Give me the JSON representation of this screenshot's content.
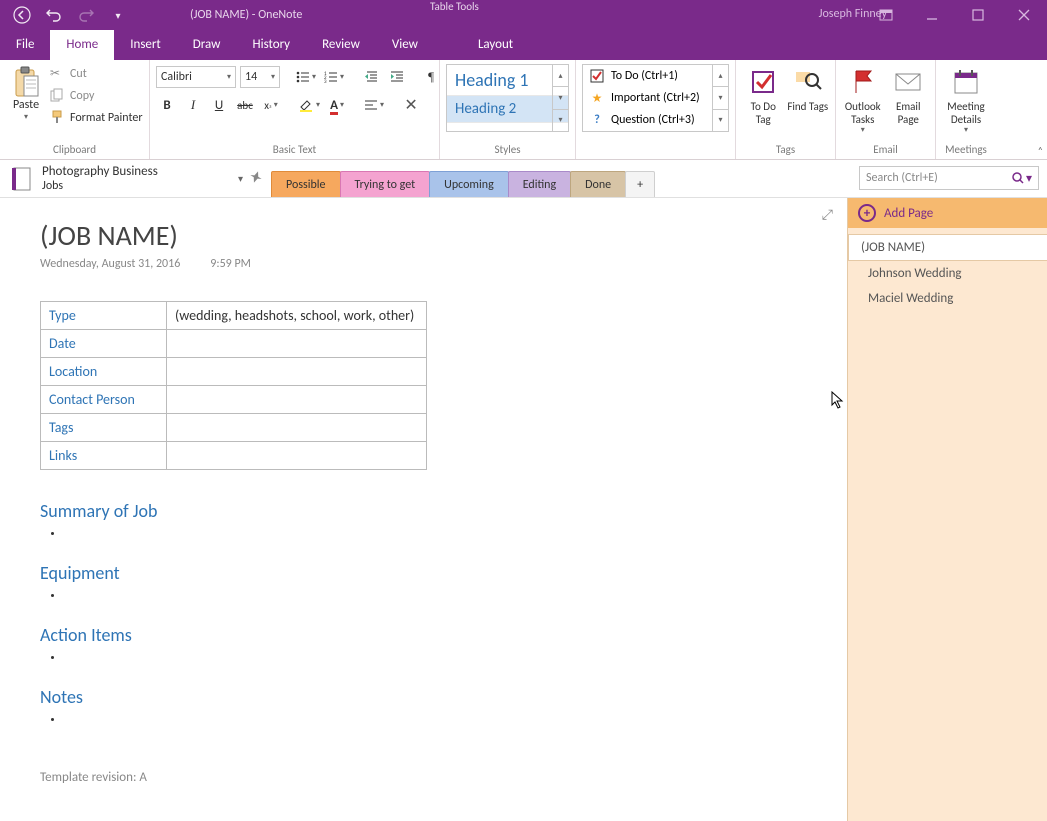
{
  "titlebar": {
    "doc_title": "(JOB NAME)  -  OneNote",
    "table_tools": "Table Tools",
    "user": "Joseph Finney"
  },
  "menu": {
    "file": "File",
    "home": "Home",
    "insert": "Insert",
    "draw": "Draw",
    "history": "History",
    "review": "Review",
    "view": "View",
    "layout": "Layout"
  },
  "ribbon": {
    "clipboard": {
      "paste": "Paste",
      "cut": "Cut",
      "copy": "Copy",
      "format_painter": "Format Painter",
      "label": "Clipboard"
    },
    "basic_text": {
      "font": "Calibri",
      "size": "14",
      "label": "Basic Text"
    },
    "styles": {
      "heading1": "Heading 1",
      "heading2": "Heading 2",
      "label": "Styles"
    },
    "tags": {
      "todo": "To Do (Ctrl+1)",
      "important": "Important (Ctrl+2)",
      "question": "Question (Ctrl+3)",
      "label": "Tags",
      "todo_tag": "To Do Tag",
      "find_tags": "Find Tags"
    },
    "email": {
      "outlook": "Outlook Tasks",
      "email_page": "Email Page",
      "label": "Email"
    },
    "meetings": {
      "details": "Meeting Details",
      "label": "Meetings"
    }
  },
  "notebook": {
    "name": "Photography Business",
    "section": "Jobs"
  },
  "tabs": {
    "possible": "Possible",
    "trying": "Trying to get",
    "upcoming": "Upcoming",
    "editing": "Editing",
    "done": "Done",
    "add": "+"
  },
  "search": {
    "placeholder": "Search (Ctrl+E)"
  },
  "pagelist": {
    "add": "Add Page",
    "p0": "(JOB NAME)",
    "p1": "Johnson Wedding",
    "p2": "Maciel  Wedding"
  },
  "page": {
    "title": "(JOB NAME)",
    "date": "Wednesday, August 31, 2016",
    "time": "9:59 PM",
    "table": {
      "r0k": "Type",
      "r0v": "(wedding, headshots, school, work, other)",
      "r1k": "Date",
      "r1v": "",
      "r2k": "Location",
      "r2v": "",
      "r3k": "Contact Person",
      "r3v": "",
      "r4k": "Tags",
      "r4v": "",
      "r5k": "Links",
      "r5v": ""
    },
    "summary_h": "Summary of Job",
    "equipment_h": "Equipment",
    "action_h": "Action Items",
    "notes_h": "Notes",
    "template_rev": "Template revision: A"
  }
}
